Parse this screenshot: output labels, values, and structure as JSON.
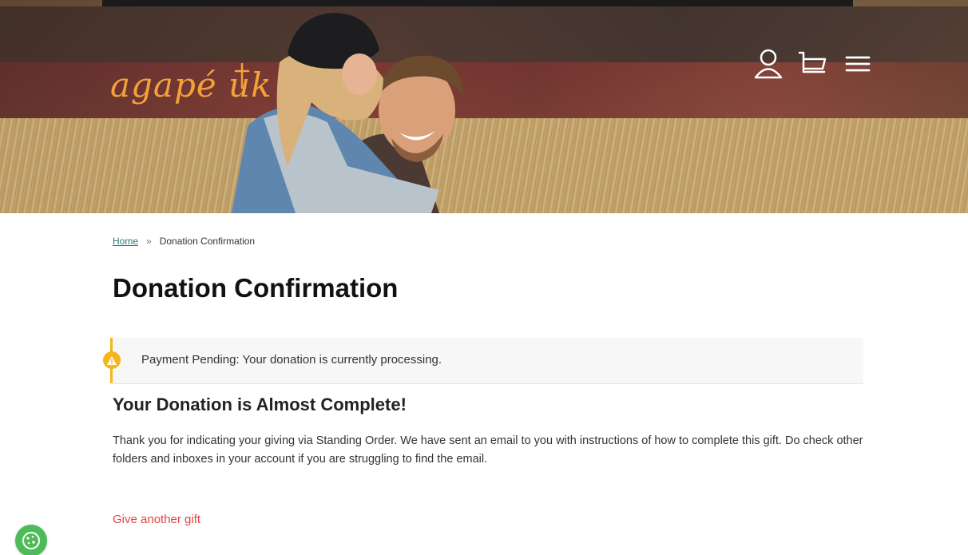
{
  "header": {
    "logo_text": "agapé uk",
    "account_icon": "user-icon",
    "cart_icon": "cart-icon",
    "menu_icon": "hamburger-menu-icon"
  },
  "breadcrumb": {
    "home_label": "Home",
    "separator": "»",
    "current_label": "Donation Confirmation"
  },
  "page": {
    "title": "Donation Confirmation"
  },
  "notice": {
    "icon": "warning-icon",
    "message": "Payment Pending: Your donation is currently processing."
  },
  "content": {
    "heading": "Your Donation is Almost Complete!",
    "body": "Thank you for indicating your giving via Standing Order. We have sent an email to you with instructions of how to complete this gift. Do check other folders and inboxes in your account if you are struggling to find the email.",
    "cta_label": "Give another gift"
  },
  "cookie": {
    "icon": "cookie-icon"
  },
  "colors": {
    "logo": "#f2a23a",
    "warning": "#f5b51b",
    "link": "#2a7a7a",
    "cta": "#e2443c",
    "cookie_button": "#4dbb57"
  }
}
